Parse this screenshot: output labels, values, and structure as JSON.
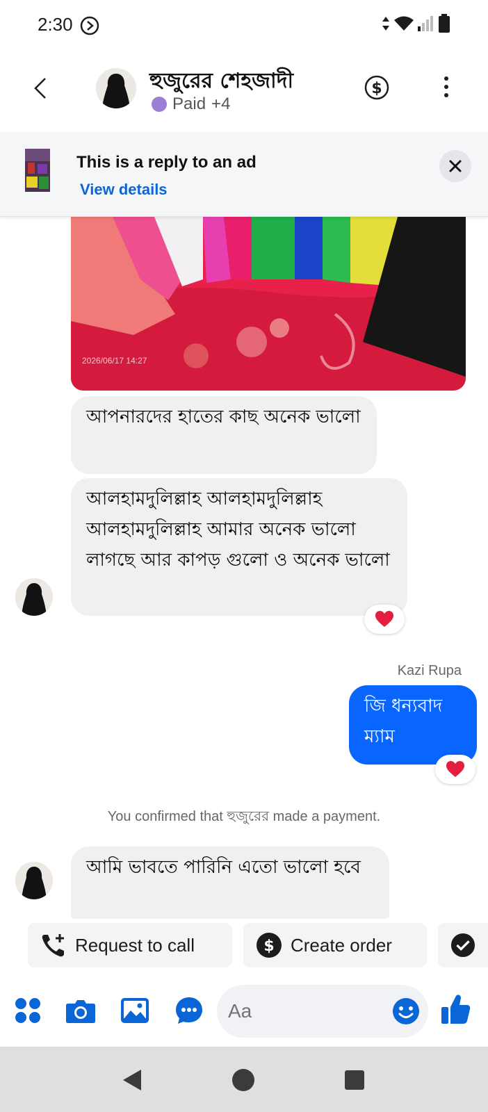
{
  "status_bar": {
    "time": "2:30"
  },
  "header": {
    "contact_name": "হুজুরের শেহজাদী",
    "paid_label": "Paid",
    "extra_count": "+4"
  },
  "ad_banner": {
    "title": "This is a reply to an ad",
    "link": "View details"
  },
  "photo": {
    "timestamp": "2026/06/17 14:27"
  },
  "messages": [
    {
      "direction": "in",
      "text": "আপনারদের হাতের কাছ অনেক ভালো"
    },
    {
      "direction": "in",
      "text": "আলহামদুলিল্লাহ  আলহামদুলিল্লাহ আলহামদুলিল্লাহ  আমার অনেক ভালো  লাগছে আর কাপড় গুলো  ও অনেক  ভালো",
      "reaction": "heart"
    },
    {
      "direction": "out",
      "sender": "Kazi Rupa",
      "text": "জি ধন্যবাদ ম্যাম",
      "reaction": "heart"
    },
    {
      "direction": "in",
      "text": "আমি ভাবতে  পারিনি এতো ভালো হবে"
    }
  ],
  "system_message": "You confirmed that হুজুরের made a payment.",
  "quick_actions": [
    {
      "label": "Request to call",
      "icon": "phone-plus-icon"
    },
    {
      "label": "Create order",
      "icon": "dollar-circle-icon"
    }
  ],
  "composer": {
    "placeholder": "Aa"
  },
  "colors": {
    "messenger_blue": "#0866ff",
    "incoming_bubble": "#f0f0f3",
    "icon_blue": "#0a66d6",
    "paid_dot": "#9b7fd4"
  }
}
